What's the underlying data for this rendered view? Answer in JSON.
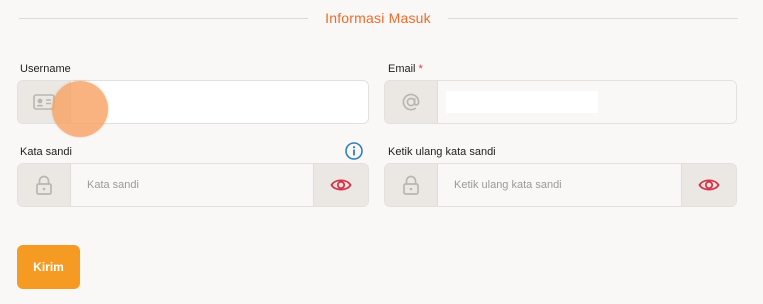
{
  "section": {
    "title": "Informasi Masuk"
  },
  "form": {
    "username": {
      "label": "Username",
      "value": "",
      "icon": "id-card-icon"
    },
    "email": {
      "label": "Email",
      "required_mark": "*",
      "value": "",
      "icon": "at-sign-icon"
    },
    "password": {
      "label": "Kata sandi",
      "placeholder": "Kata sandi",
      "icon": "lock-icon",
      "toggle_icon": "eye-icon",
      "info_icon": "info-icon"
    },
    "confirm_password": {
      "label": "Ketik ulang kata sandi",
      "placeholder": "Ketik ulang kata sandi",
      "icon": "lock-icon",
      "toggle_icon": "eye-icon"
    },
    "submit_label": "Kirim"
  },
  "colors": {
    "accent_orange": "#f06a2a",
    "button_orange": "#f59b23",
    "eye_red": "#d9344a",
    "info_blue": "#2f7fc1",
    "icon_gray": "#b9b6b1"
  }
}
